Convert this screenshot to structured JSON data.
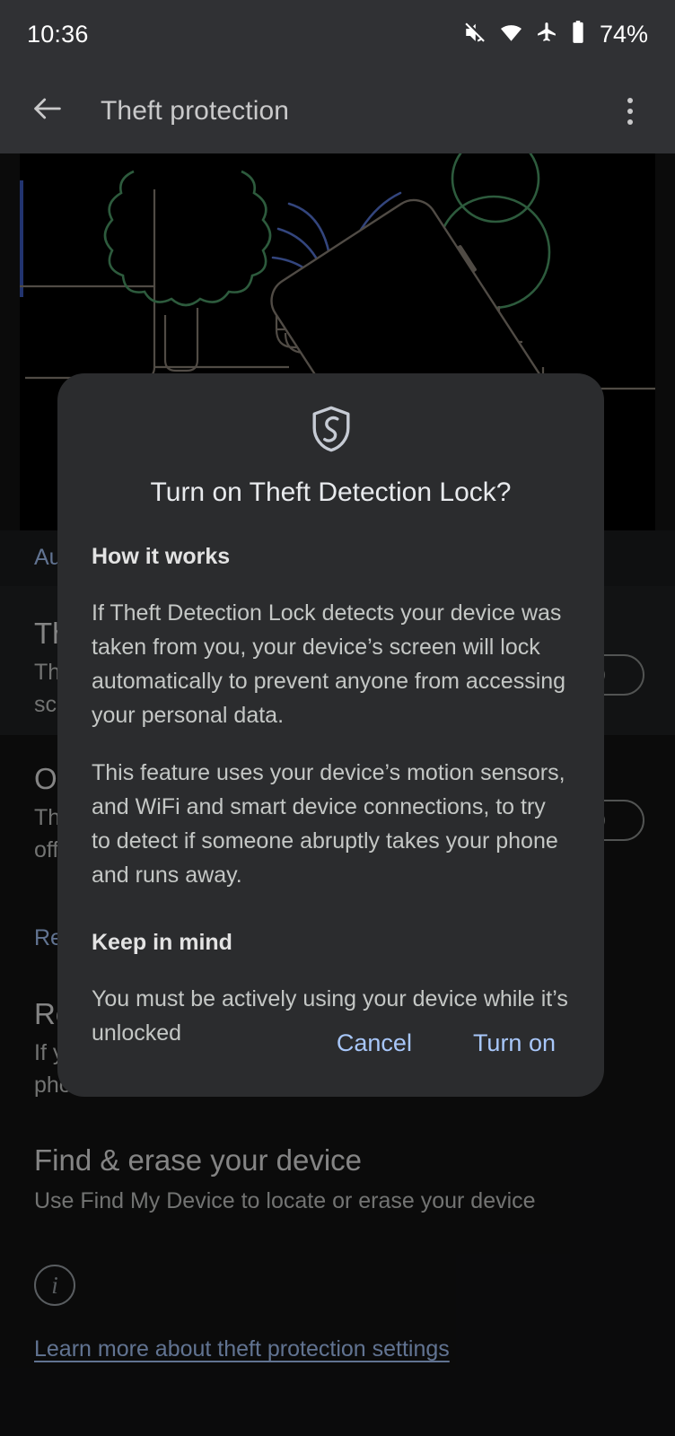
{
  "status_bar": {
    "time": "10:36",
    "battery_percent": "74%",
    "icons": [
      "volume-mute-icon",
      "wifi-icon",
      "airplane-mode-icon",
      "battery-icon"
    ]
  },
  "app_bar": {
    "back_label": "Back",
    "title": "Theft protection",
    "overflow_label": "More options"
  },
  "hero": {
    "description": "Illustration of a hand grabbing an unlocked phone in a park with trees, a bench and a fountain",
    "colors": {
      "background": "#000000",
      "outline": "#8a8277",
      "tree": "#4f9d69",
      "water": "#5878d8",
      "hand": "#9e9e9e"
    }
  },
  "background_page": {
    "auto_link": "Automatic phone lock settings",
    "items": [
      {
        "title": "Theft Detection Lock",
        "subtitle_line1": "This locks your phone's",
        "subtitle_line2": "screen if someone grabs it",
        "toggle_state": "off"
      },
      {
        "title": "Offline Device Lock",
        "subtitle_line1": "This locks your phone's screen if it goes",
        "subtitle_line2": "offline for a long time",
        "toggle_state": "off"
      }
    ],
    "remote_link": "Remote Lock",
    "remote_title": "Remote lock",
    "remote_sub_line1": "If your phone is lost or stolen, lock your",
    "remote_sub_line2": "phone with just your phone number",
    "find_section": {
      "title": "Find & erase your device",
      "subtitle": "Use Find My Device to locate or erase your device"
    },
    "info_icon_label": "i",
    "learn_more": "Learn more about theft protection settings"
  },
  "dialog": {
    "icon": "shield-security-icon",
    "title": "Turn on Theft Detection Lock?",
    "sections": [
      {
        "heading": "How it works",
        "paragraphs": [
          "If Theft Detection Lock detects your device was taken from you, your device’s screen will lock automatically to prevent anyone from accessing your personal data.",
          "This feature uses your device’s motion sensors, and WiFi and smart device connections, to try to detect if someone abruptly takes your phone and runs away."
        ]
      },
      {
        "heading": "Keep in mind",
        "paragraphs": [
          "You must be actively using your device while it’s unlocked"
        ]
      }
    ],
    "cancel_label": "Cancel",
    "confirm_label": "Turn on",
    "accent_color": "#a8c7fa",
    "surface_color": "#2b2c2e"
  }
}
